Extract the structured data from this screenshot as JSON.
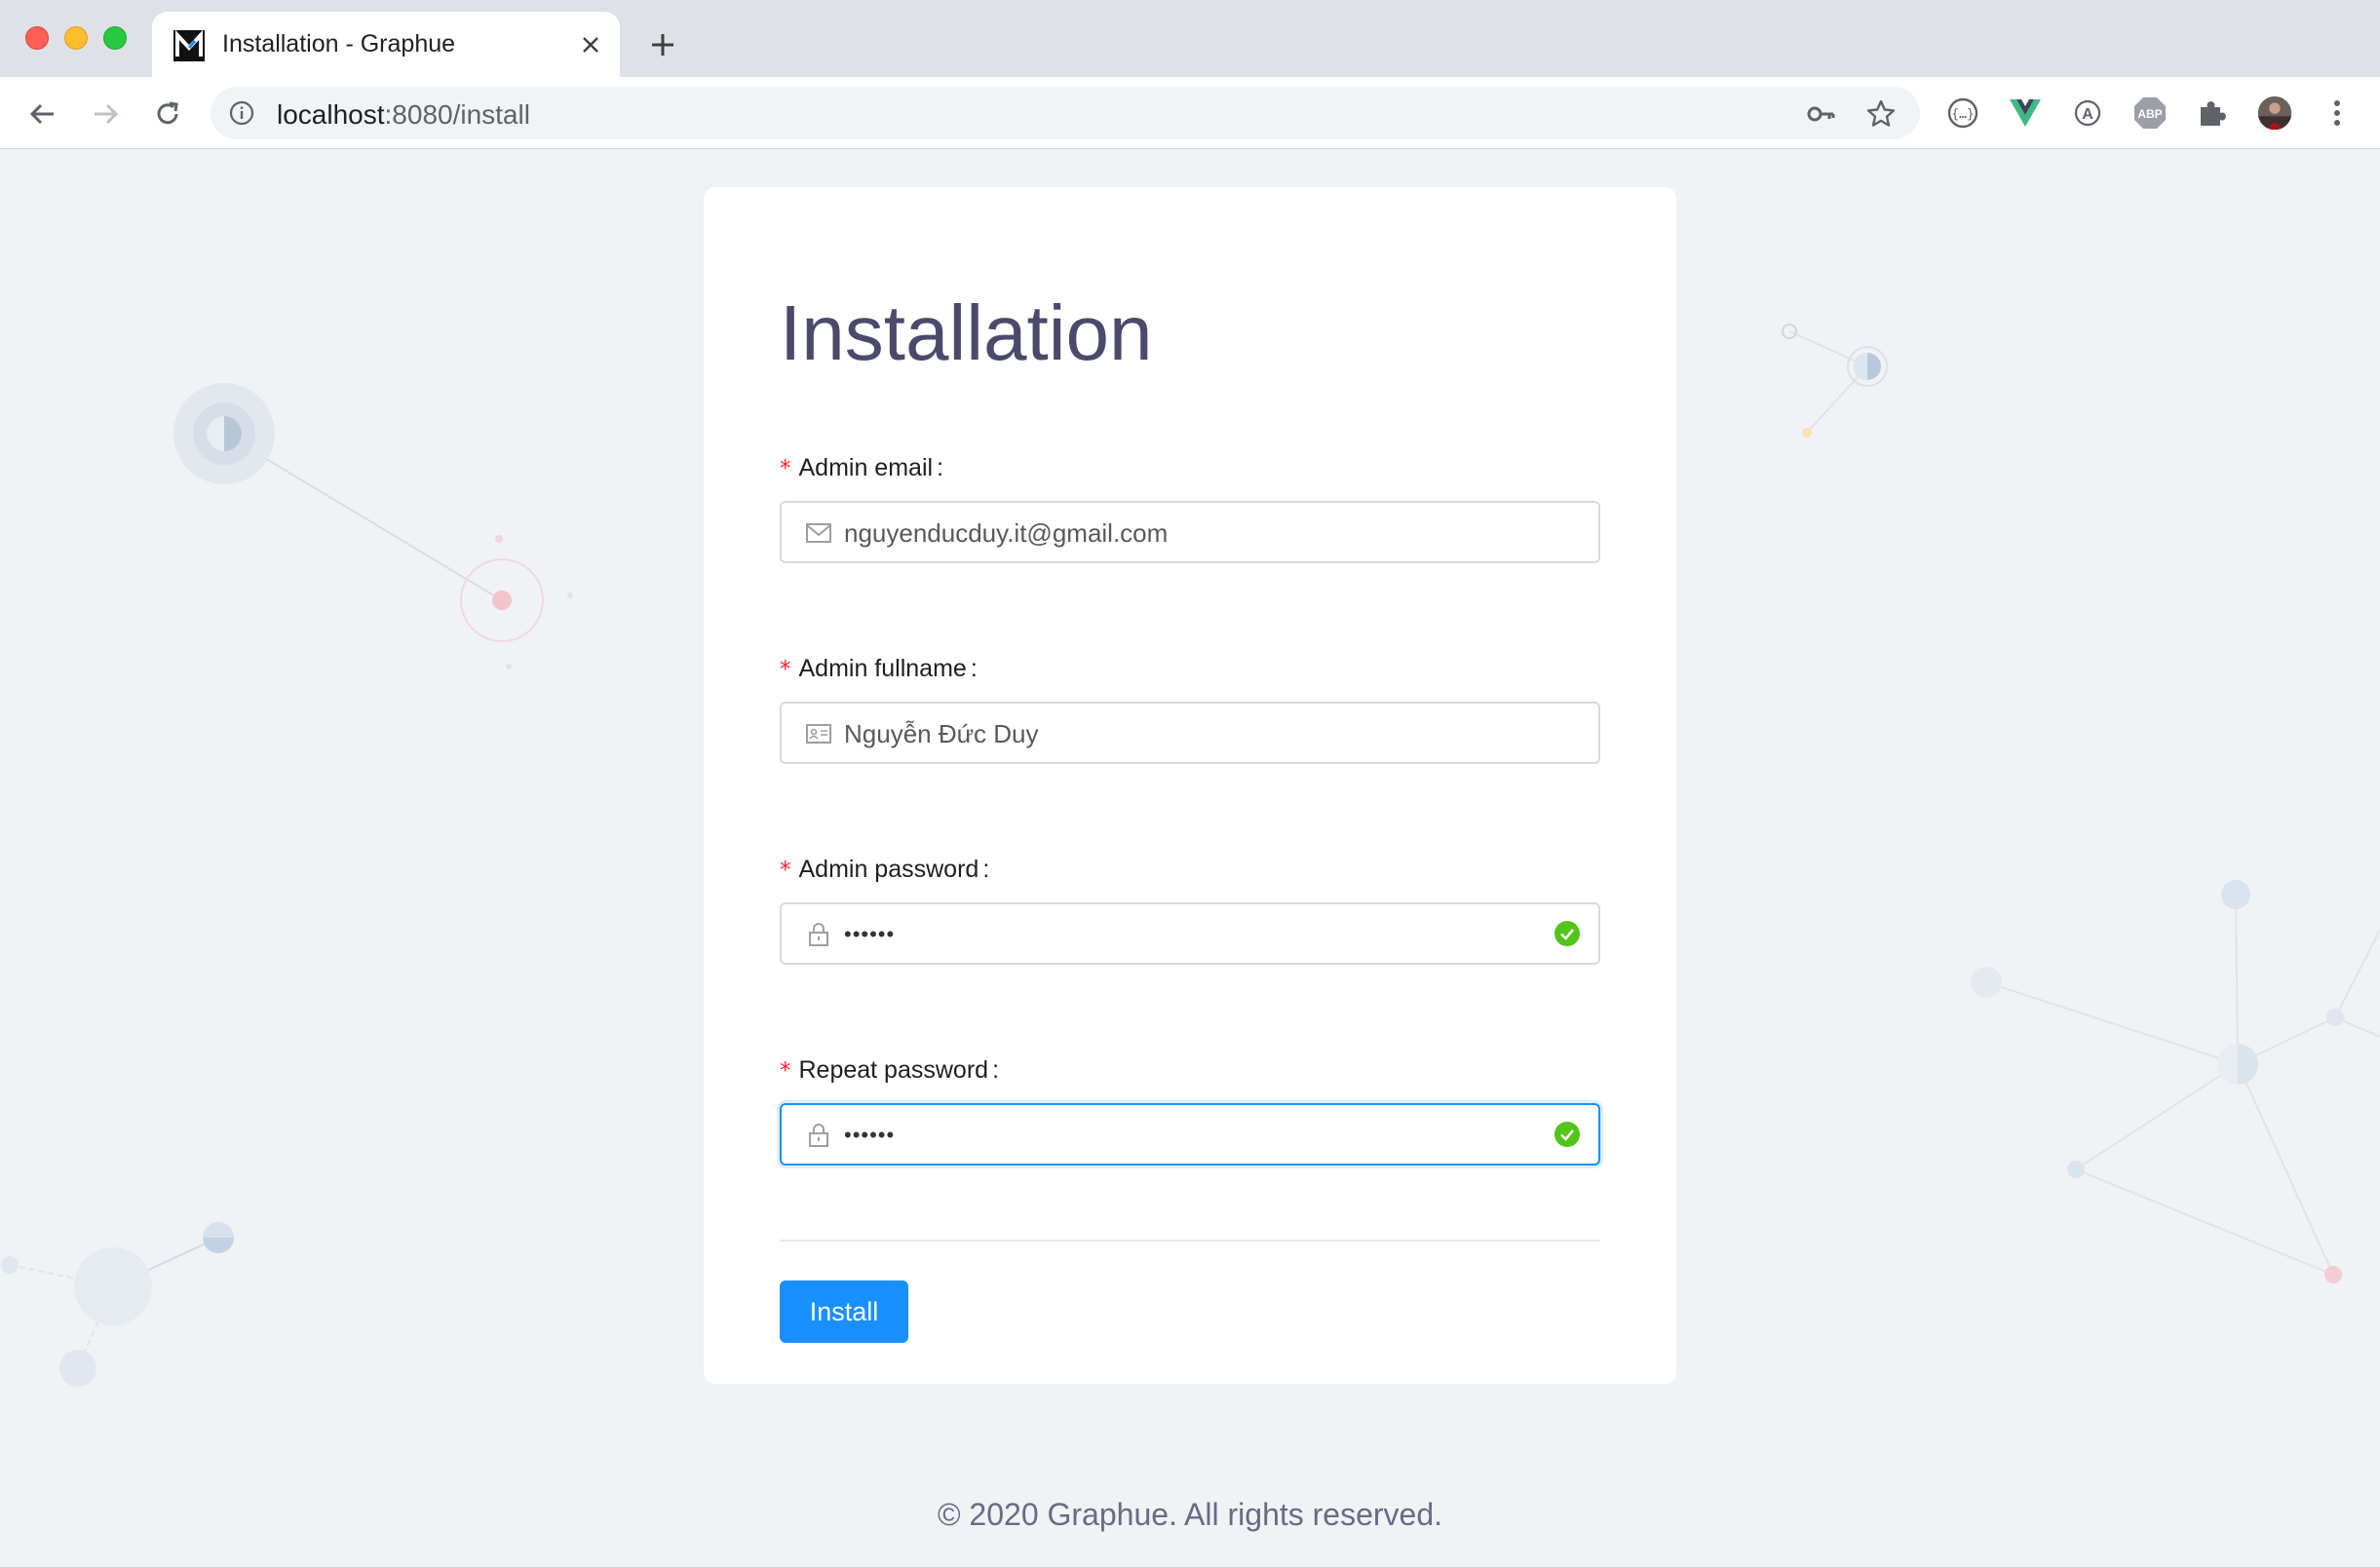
{
  "browser": {
    "tab_title": "Installation - Graphue",
    "url_host": "localhost",
    "url_rest": ":8080/install"
  },
  "form": {
    "title": "Installation",
    "fields": [
      {
        "label": "Admin email",
        "value": "nguyenducduy.it@gmail.com",
        "prefix_icon": "mail-icon",
        "valid": false
      },
      {
        "label": "Admin fullname",
        "value": "Nguyễn Đức Duy",
        "prefix_icon": "id-card-icon",
        "valid": false
      },
      {
        "label": "Admin password",
        "value": "••••••",
        "prefix_icon": "lock-icon",
        "valid": true
      },
      {
        "label": "Repeat password",
        "value": "••••••",
        "prefix_icon": "lock-icon",
        "valid": true,
        "focused": true
      }
    ],
    "required_mark": "*",
    "colon": ":",
    "submit_label": "Install"
  },
  "footer": {
    "text": "© 2020 Graphue. All rights reserved."
  },
  "colors": {
    "primary": "#1890ff",
    "success": "#52c41a",
    "required": "#f5222d",
    "title": "#4b4a6b"
  }
}
